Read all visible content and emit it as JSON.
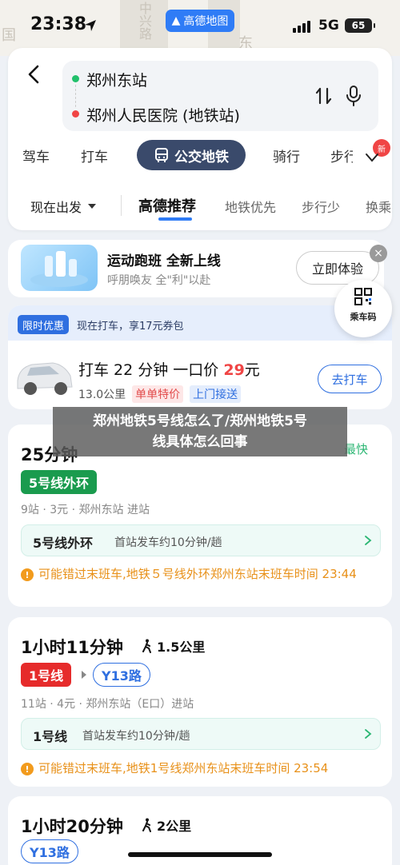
{
  "status_bar": {
    "time": "23:38",
    "network": "5G",
    "battery": "65",
    "app_chip": "高德地图"
  },
  "map_bg": {
    "labels": [
      "国",
      "中兴路",
      "东"
    ]
  },
  "search": {
    "from": "郑州东站",
    "to": "郑州人民医院 (地铁站)"
  },
  "mode_tabs": {
    "drive": "驾车",
    "taxi": "打车",
    "transit": "公交地铁",
    "bike": "骑行",
    "walk": "步行",
    "new_badge": "新"
  },
  "sub_tabs": {
    "depart": "现在出发",
    "recommend": "高德推荐",
    "subway_first": "地铁优先",
    "less_walk": "步行少",
    "less_transfer": "换乘"
  },
  "promo": {
    "title": "运动跑班 全新上线",
    "subtitle": "呼朋唤友 全\"利\"以赴",
    "button": "立即体验",
    "close": "×"
  },
  "qr_fab": {
    "label": "乘车码"
  },
  "taxi": {
    "badge": "限时优惠",
    "promo_text": "现在打车，享17元券包",
    "title_prefix": "打车 22 分钟 一口价 ",
    "price": "29",
    "price_unit": "元",
    "distance": "13.0公里",
    "tag1": "单单特价",
    "tag2": "上门接送",
    "button": "去打车"
  },
  "overlay": {
    "line1": "郑州地铁5号线怎么了/郑州地铁5号",
    "line2": "线具体怎么回事"
  },
  "routes": [
    {
      "time": "25分钟",
      "tag": "最快",
      "line": "5号线外环",
      "meta": "9站 · 3元 · 郑州东站 进站",
      "detail_line": "5号线外环",
      "detail_info": "首站发车约10分钟/趟",
      "warning": "可能错过末班车,地铁５号线外环郑州东站末班车时间 23:44"
    },
    {
      "time": "1小时11分钟",
      "walk": "1.5公里",
      "line1": "1号线",
      "line2": "Y13路",
      "meta": "11站 · 4元 · 郑州东站（E口）进站",
      "detail_line": "1号线",
      "detail_info": "首站发车约10分钟/趟",
      "warning": "可能错过末班车,地铁1号线郑州东站末班车时间 23:54"
    },
    {
      "time": "1小时20分钟",
      "walk": "2公里",
      "line1": "Y13路"
    }
  ],
  "colors": {
    "accent": "#2f7cf6",
    "active_tab": "#3a4a6b",
    "line5": "#1a9b4e",
    "line1": "#e62b2b",
    "warning": "#e8911a"
  }
}
